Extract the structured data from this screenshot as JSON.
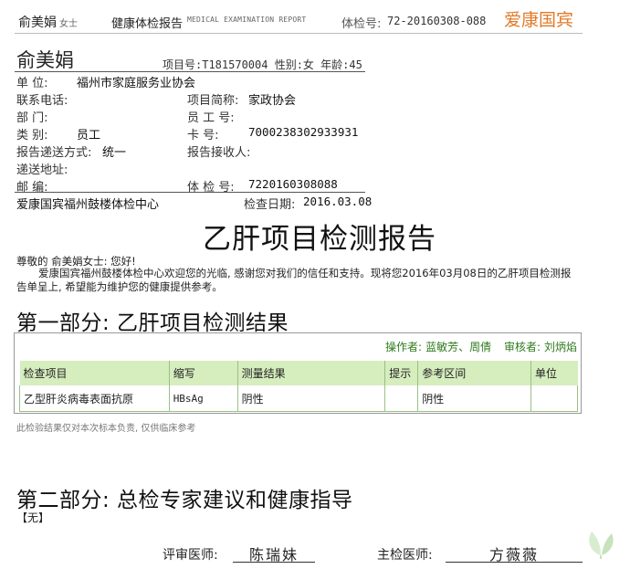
{
  "header": {
    "name": "俞美娟",
    "salutation": "女士",
    "title": "健康体检报告",
    "title_en": "MEDICAL EXAMINATION REPORT",
    "report_no_label": "体检号:",
    "report_no": "72-20160308-088",
    "brand": "爱康国宾"
  },
  "patient": {
    "name": "俞美娟",
    "meta": "项目号:T181570004 性别:女 年龄:45",
    "fields": {
      "unit_label": "单    位:",
      "unit_value": "福州市家庭服务业协会",
      "phone_label": "联系电话:",
      "project_label": "项目简称:",
      "project_value": "家政协会",
      "dept_label": "部    门:",
      "staffno_label": "员 工 号:",
      "category_label": "类    别:",
      "category_value": "员工",
      "card_label": "卡    号:",
      "card_value": "7000238302933931",
      "delivery_label": "报告递送方式:",
      "delivery_value": "统一",
      "receiver_label": "报告接收人:",
      "address_label": "递送地址:",
      "postal_label": "邮    编:",
      "exam_no_label": "体 检 号:",
      "exam_no_value": "7220160308088",
      "center": "爱康国宾福州鼓楼体检中心",
      "exam_date_label": "检查日期:",
      "exam_date_value": "2016.03.08"
    }
  },
  "report": {
    "title": "乙肝项目检测报告",
    "greeting": "尊敬的 俞美娟女士: 您好!",
    "paragraph": "爱康国宾福州鼓楼体检中心欢迎您的光临, 感谢您对我们的信任和支持。现将您2016年03月08日的乙肝项目检测报告单呈上, 希望能为维护您的健康提供参考。"
  },
  "part1": {
    "title": "第一部分: 乙肝项目检测结果",
    "operator_label": "操作者:",
    "operator": "蓝敏芳、周倩",
    "reviewer_label": "审核者:",
    "reviewer": "刘炳焰",
    "columns": [
      "检查项目",
      "缩写",
      "测量结果",
      "提示",
      "参考区间",
      "单位"
    ],
    "rows": [
      [
        "乙型肝炎病毒表面抗原",
        "HBsAg",
        "阴性",
        "",
        "阴性",
        ""
      ]
    ],
    "disclaimer": "此检验结果仅对本次标本负责, 仅供临床参考"
  },
  "part2": {
    "title": "第二部分: 总检专家建议和健康指导",
    "content": "【无】"
  },
  "signatures": {
    "reviewer_label": "评审医师:",
    "reviewer_name": "陈瑞妹",
    "chief_label": "主检医师:",
    "chief_name": "方薇薇"
  },
  "colors": {
    "brand": "#e07a2a",
    "table_header": "#d6edbe",
    "staff_text": "#2f7a1c"
  }
}
